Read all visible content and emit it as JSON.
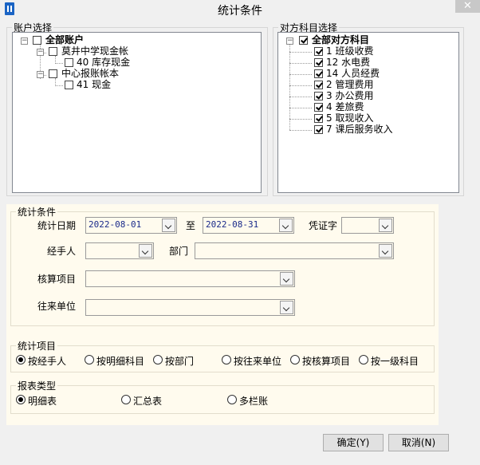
{
  "window": {
    "title": "统计条件",
    "close_glyph": "✕"
  },
  "accounts": {
    "legend": "账户选择",
    "root": "全部账户",
    "groups": [
      {
        "label": "莫井中学现金帐",
        "children": [
          "40 库存现金"
        ]
      },
      {
        "label": "中心报账帐本",
        "children": [
          "41 现金"
        ]
      }
    ]
  },
  "subjects": {
    "legend": "对方科目选择",
    "root": "全部对方科目",
    "items": [
      "1 班级收费",
      "12 水电费",
      "14 人员经费",
      "2 管理费用",
      "3 办公费用",
      "4 差旅费",
      "5 取现收入",
      "7 课后服务收入"
    ]
  },
  "conditions": {
    "legend": "统计条件",
    "date_label": "统计日期",
    "date_from": "2022-08-01",
    "to_label": "至",
    "date_to": "2022-08-31",
    "voucher_label": "凭证字",
    "voucher_value": "",
    "handler_label": "经手人",
    "handler_value": "",
    "dept_label": "部门",
    "dept_value": "",
    "item_label": "核算项目",
    "item_value": "",
    "unit_label": "往来单位",
    "unit_value": ""
  },
  "stat_items": {
    "legend": "统计项目",
    "options": [
      "按经手人",
      "按明细科目",
      "按部门",
      "按往来单位",
      "按核算项目",
      "按一级科目"
    ],
    "selected": 0
  },
  "report_type": {
    "legend": "报表类型",
    "options": [
      "明细表",
      "汇总表",
      "多栏账"
    ],
    "selected": 0
  },
  "buttons": {
    "ok": "确定(Y)",
    "cancel": "取消(N)"
  }
}
